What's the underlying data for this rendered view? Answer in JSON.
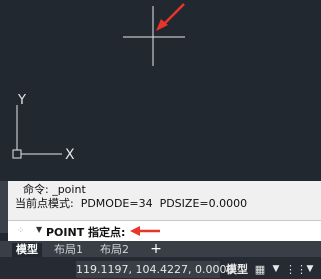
{
  "command_history": {
    "line1": "命令: _point",
    "line2": "当前点模式:  PDMODE=34  PDSIZE=0.0000"
  },
  "command_input": {
    "prompt": "POINT 指定点:"
  },
  "layout_tabs": [
    {
      "label": "模型",
      "active": true
    },
    {
      "label": "布局1",
      "active": false
    },
    {
      "label": "布局2",
      "active": false
    }
  ],
  "add_tab_label": "+",
  "status_bar": {
    "coordinates": "119.1197, 104.4227, 0.0000",
    "model_label": "模型"
  },
  "ucs": {
    "x_label": "X",
    "y_label": "Y"
  },
  "colors": {
    "canvas": "#222830",
    "annotation_arrow": "#e8352a"
  }
}
